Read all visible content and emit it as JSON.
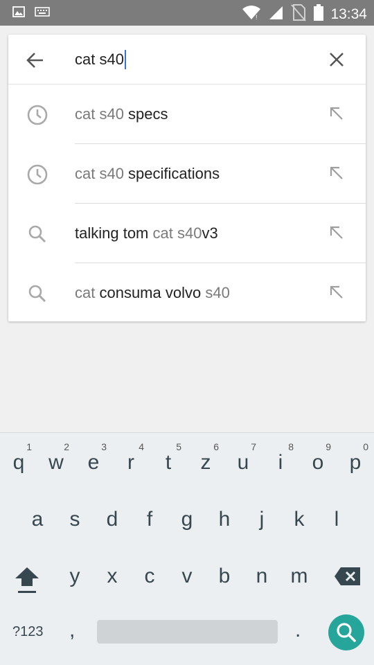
{
  "status_bar": {
    "time": "13:34"
  },
  "search": {
    "query": "cat s40",
    "back_icon": "arrow-back-icon",
    "clear_icon": "close-icon"
  },
  "suggestions": [
    {
      "icon": "history-icon",
      "parts": [
        {
          "t": "cat s40 ",
          "style": "light"
        },
        {
          "t": "specs",
          "style": "dark"
        }
      ]
    },
    {
      "icon": "history-icon",
      "parts": [
        {
          "t": "cat s40 ",
          "style": "light"
        },
        {
          "t": "specifications",
          "style": "dark"
        }
      ]
    },
    {
      "icon": "search-icon",
      "parts": [
        {
          "t": "talking tom ",
          "style": "dark"
        },
        {
          "t": "cat s40",
          "style": "light"
        },
        {
          "t": "v3",
          "style": "dark"
        }
      ]
    },
    {
      "icon": "search-icon",
      "parts": [
        {
          "t": "cat ",
          "style": "light"
        },
        {
          "t": "consuma volvo ",
          "style": "dark"
        },
        {
          "t": "s40",
          "style": "light"
        }
      ]
    }
  ],
  "keyboard": {
    "row1": [
      {
        "k": "q",
        "h": "1"
      },
      {
        "k": "w",
        "h": "2"
      },
      {
        "k": "e",
        "h": "3"
      },
      {
        "k": "r",
        "h": "4"
      },
      {
        "k": "t",
        "h": "5"
      },
      {
        "k": "z",
        "h": "6"
      },
      {
        "k": "u",
        "h": "7"
      },
      {
        "k": "i",
        "h": "8"
      },
      {
        "k": "o",
        "h": "9"
      },
      {
        "k": "p",
        "h": "0"
      }
    ],
    "row2": [
      "a",
      "s",
      "d",
      "f",
      "g",
      "h",
      "j",
      "k",
      "l"
    ],
    "row3": [
      "y",
      "x",
      "c",
      "v",
      "b",
      "n",
      "m"
    ],
    "symbols_label": "?123",
    "comma": ",",
    "period": ".",
    "accent_color": "#26a69a"
  }
}
